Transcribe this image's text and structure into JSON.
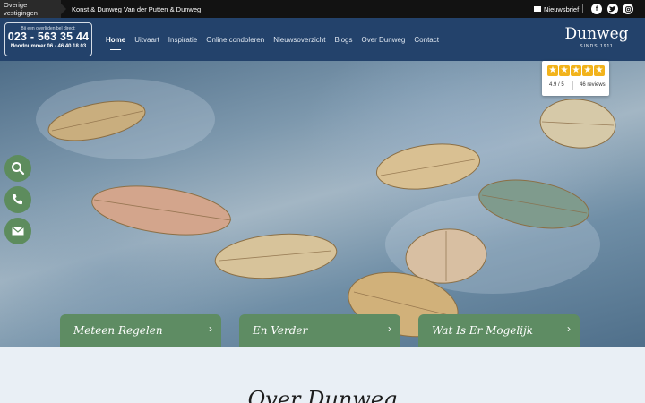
{
  "topbar": {
    "locations_label": "Overige vestigingen",
    "locations": [
      "Konst & Dunweg",
      "Van der Putten & Dunweg"
    ],
    "newsletter": "Nieuwsbrief",
    "social_icons": [
      "facebook-icon",
      "twitter-icon",
      "instagram-icon"
    ]
  },
  "phone_box": {
    "caption": "Bij een overlijden bel direct:",
    "number": "023 - 563 35 44",
    "night": "Noodnummer 06 - 46 40 18 03"
  },
  "nav": {
    "items": [
      "Home",
      "Uitvaart",
      "Inspiratie",
      "Online condoleren",
      "Nieuwsoverzicht",
      "Blogs",
      "Over Dunweg",
      "Contact"
    ],
    "active": "Home"
  },
  "logo": {
    "name": "Dunweg",
    "tagline": "SINDS 1911"
  },
  "rating": {
    "score": "4.9 / 5",
    "reviews": "46 reviews",
    "stars": 5
  },
  "side_actions": [
    "search-icon",
    "phone-icon",
    "mail-icon"
  ],
  "cta": [
    "Meteen Regelen",
    "En Verder",
    "Wat Is Er Mogelijk"
  ],
  "about": {
    "title": "Over Dunweg"
  },
  "colors": {
    "header": "#23426b",
    "accent_green": "#5e8c63",
    "star": "#f2b31b"
  }
}
